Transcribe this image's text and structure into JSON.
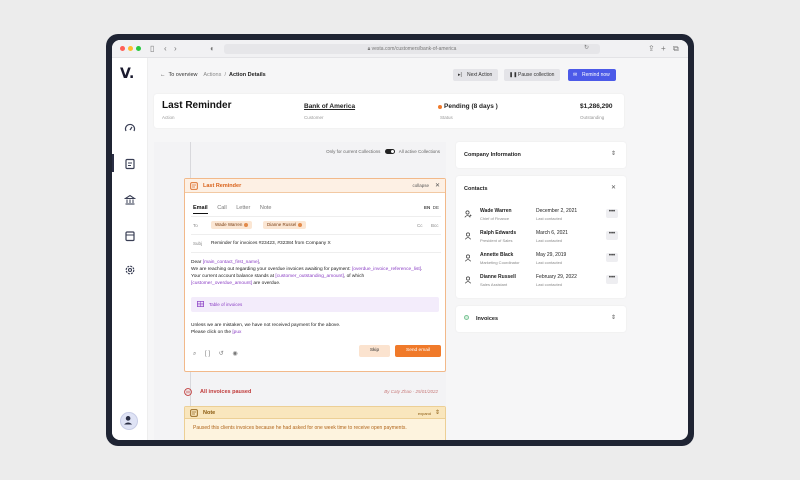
{
  "browser": {
    "url": "vesta.com/customers/bank-of-america"
  },
  "sidebar": {
    "logo": "V.",
    "items": [
      {
        "icon": "dashboard-icon"
      },
      {
        "icon": "document-icon"
      },
      {
        "icon": "bank-icon"
      },
      {
        "icon": "calendar-icon"
      },
      {
        "icon": "gear-icon"
      }
    ],
    "avatar_icon": "user-icon"
  },
  "topbar": {
    "back": "To overview",
    "crumb_actions": "Actions",
    "sep": "/",
    "crumb_current": "Action Details",
    "next_action": "Next Action",
    "pause_collection": "Pause collection",
    "remind_now": "Remind now"
  },
  "header": {
    "title": "Last Reminder",
    "title_label": "Action",
    "customer": "Bank of America",
    "customer_label": "Customer",
    "status": "Pending (8 days )",
    "status_label": "Status",
    "status_color": "#f07a2a",
    "amount": "$1,286,290",
    "amount_label": "Outstanding"
  },
  "timeline": {
    "toggle_left": "Only for current Collections",
    "toggle_right": "All active Collections",
    "reminder": {
      "title": "Last Reminder",
      "collapse": "collapse",
      "tabs": [
        "Email",
        "Call",
        "Letter",
        "Note"
      ],
      "active_tab": "Email",
      "lang_active": "EN",
      "lang_other": "DE",
      "to_label": "To",
      "recipients": [
        "Wade Warren",
        "Dianne Russel"
      ],
      "cc": "Cc",
      "bcc": "Bcc",
      "subject_label": "Subj",
      "subject": "Reminder for invoices #23423, #32384 from Company X",
      "line1_a": "Dear ",
      "line1_var": "[main_contact_first_name]",
      "line1_b": ",",
      "line2_a": "We are reaching out regarding your overdue invoices awaiting for payment: ",
      "line2_var": "[overdue_invoice_reference_list]",
      "line2_b": ".",
      "line3_a": "Your current account balance stands at ",
      "line3_var": "[customer_outstanding_amount]",
      "line3_b": ", of which",
      "line4_var": "[customer_overdue_amount]",
      "line4_b": " are overdue.",
      "table_label": "Table of invoices",
      "line5": "Unless we are mistaken, we have not received payment for the above.",
      "line6_a": "Please click on the ",
      "line6_var": "[pux",
      "skip": "Skip",
      "send": "Send email"
    },
    "paused": {
      "title": "All invoices paused",
      "meta": "By Caty Zhao · 25/01/2022"
    },
    "note": {
      "title": "Note",
      "expand": "expand",
      "text": "Paused this clients invoices because he had asked for one week time to receive open payments."
    }
  },
  "right": {
    "company_info": "Company Information",
    "contacts_title": "Contacts",
    "contacts": [
      {
        "name": "Wade Warren",
        "role": "Chief of Finance",
        "date": "December 2, 2021",
        "last": "Last contacted",
        "icon": "user-plus-icon"
      },
      {
        "name": "Ralph Edwards",
        "role": "President of Sales",
        "date": "March 6, 2021",
        "last": "Last contacted",
        "icon": "user-icon"
      },
      {
        "name": "Annette Black",
        "role": "Marketing Coordinator",
        "date": "May 29, 2019",
        "last": "Last contacted",
        "icon": "user-icon"
      },
      {
        "name": "Dianne Russell",
        "role": "Sales Assistant",
        "date": "February 29, 2022",
        "last": "Last contacted",
        "icon": "user-icon"
      }
    ],
    "more": "•••",
    "invoices": "Invoices"
  }
}
